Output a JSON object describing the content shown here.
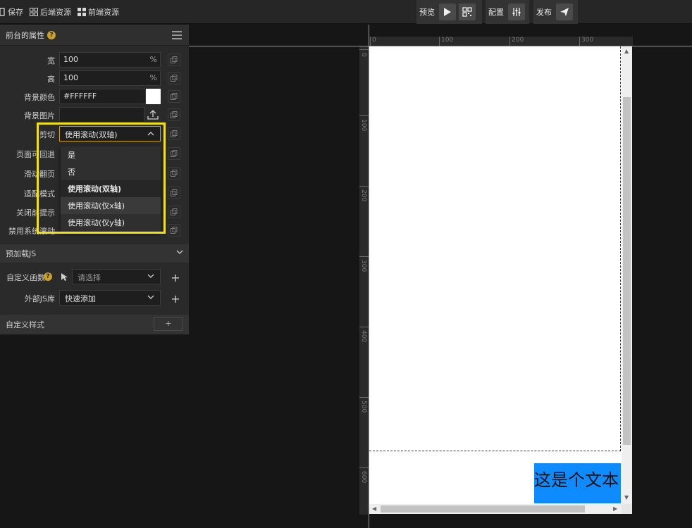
{
  "toolbar": {
    "save": "保存",
    "backend_resources": "后端资源",
    "frontend_resources": "前端资源",
    "preview": "预览",
    "config": "配置",
    "publish": "发布"
  },
  "panel": {
    "title": "前台的属性",
    "help": "?",
    "width_label": "宽",
    "width_value": "100",
    "height_label": "高",
    "height_value": "100",
    "unit": "%",
    "bgcolor_label": "背景颜色",
    "bgcolor_value": "#FFFFFF",
    "bgimage_label": "背景图片",
    "clip_label": "剪切",
    "clip_value": "使用滚动(双轴)",
    "hidden_labels": [
      "页面可回退",
      "滑动翻页",
      "适配模式",
      "关闭前提示",
      "禁用系统滚动"
    ],
    "dropdown_options": [
      "是",
      "否",
      "使用滚动(双轴)",
      "使用滚动(仅x轴)",
      "使用滚动(仅y轴)"
    ]
  },
  "sections": {
    "preload_js": "预加载JS",
    "custom_func_label": "自定义函数",
    "custom_func_placeholder": "请选择",
    "external_js_label": "外部JS库",
    "external_js_value": "快速添加",
    "custom_style": "自定义样式",
    "add": "+"
  },
  "ruler": {
    "top": [
      "0",
      "100",
      "200",
      "300"
    ],
    "left": [
      "0",
      "100",
      "200",
      "300",
      "400",
      "500",
      "600"
    ]
  },
  "canvas": {
    "text_block": "这是个文本"
  },
  "colors": {
    "accent": "#c9a227",
    "highlight": "#f2e20f",
    "guide": "#22c3d1",
    "text_block_bg": "#0d8bff"
  }
}
